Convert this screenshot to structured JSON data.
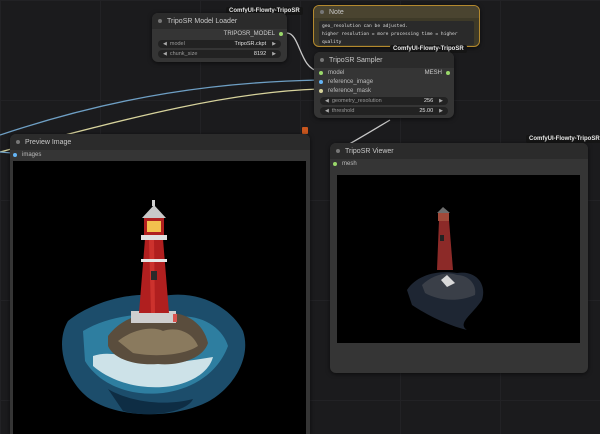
{
  "colors": {
    "canvas": "#1b1b1d",
    "node_body": "#353535",
    "node_title": "#2b2b2b",
    "note_body": "#3e3a28",
    "note_border": "#b4892e",
    "wire_blue": "#6e9fc4",
    "wire_yellow": "#d7d39c",
    "wire_white": "#c8c8c8",
    "mesh_dot": "#9ad86a",
    "image_dot": "#64b5f6"
  },
  "model_loader": {
    "tag": "ComfyUI-Flowty-TripoSR",
    "title": "TripoSR Model Loader",
    "output_label": "TRIPOSR_MODEL",
    "widgets": [
      {
        "label": "model",
        "value": "TripoSR.ckpt"
      },
      {
        "label": "chunk_size",
        "value": "8192"
      }
    ]
  },
  "note": {
    "title": "Note",
    "line1": "geo_resolution can be adjusted.",
    "line2": "higher resolution = more processing time = higher quality",
    "tag": "ComfyUI-Flowty-TripoSR"
  },
  "sampler": {
    "title": "TripoSR Sampler",
    "inputs": [
      "model",
      "reference_image",
      "reference_mask"
    ],
    "output_label": "MESH",
    "widgets": [
      {
        "label": "geometry_resolution",
        "value": "256"
      },
      {
        "label": "threshold",
        "value": "25.00"
      }
    ]
  },
  "preview": {
    "title": "Preview Image",
    "input_label": "images",
    "image_alt": "red lighthouse on rocky island"
  },
  "viewer": {
    "tag": "ComfyUI-Flowty-TripoSR",
    "title": "TripoSR Viewer",
    "input_label": "mesh",
    "render_alt": "3D mesh render of lighthouse"
  }
}
